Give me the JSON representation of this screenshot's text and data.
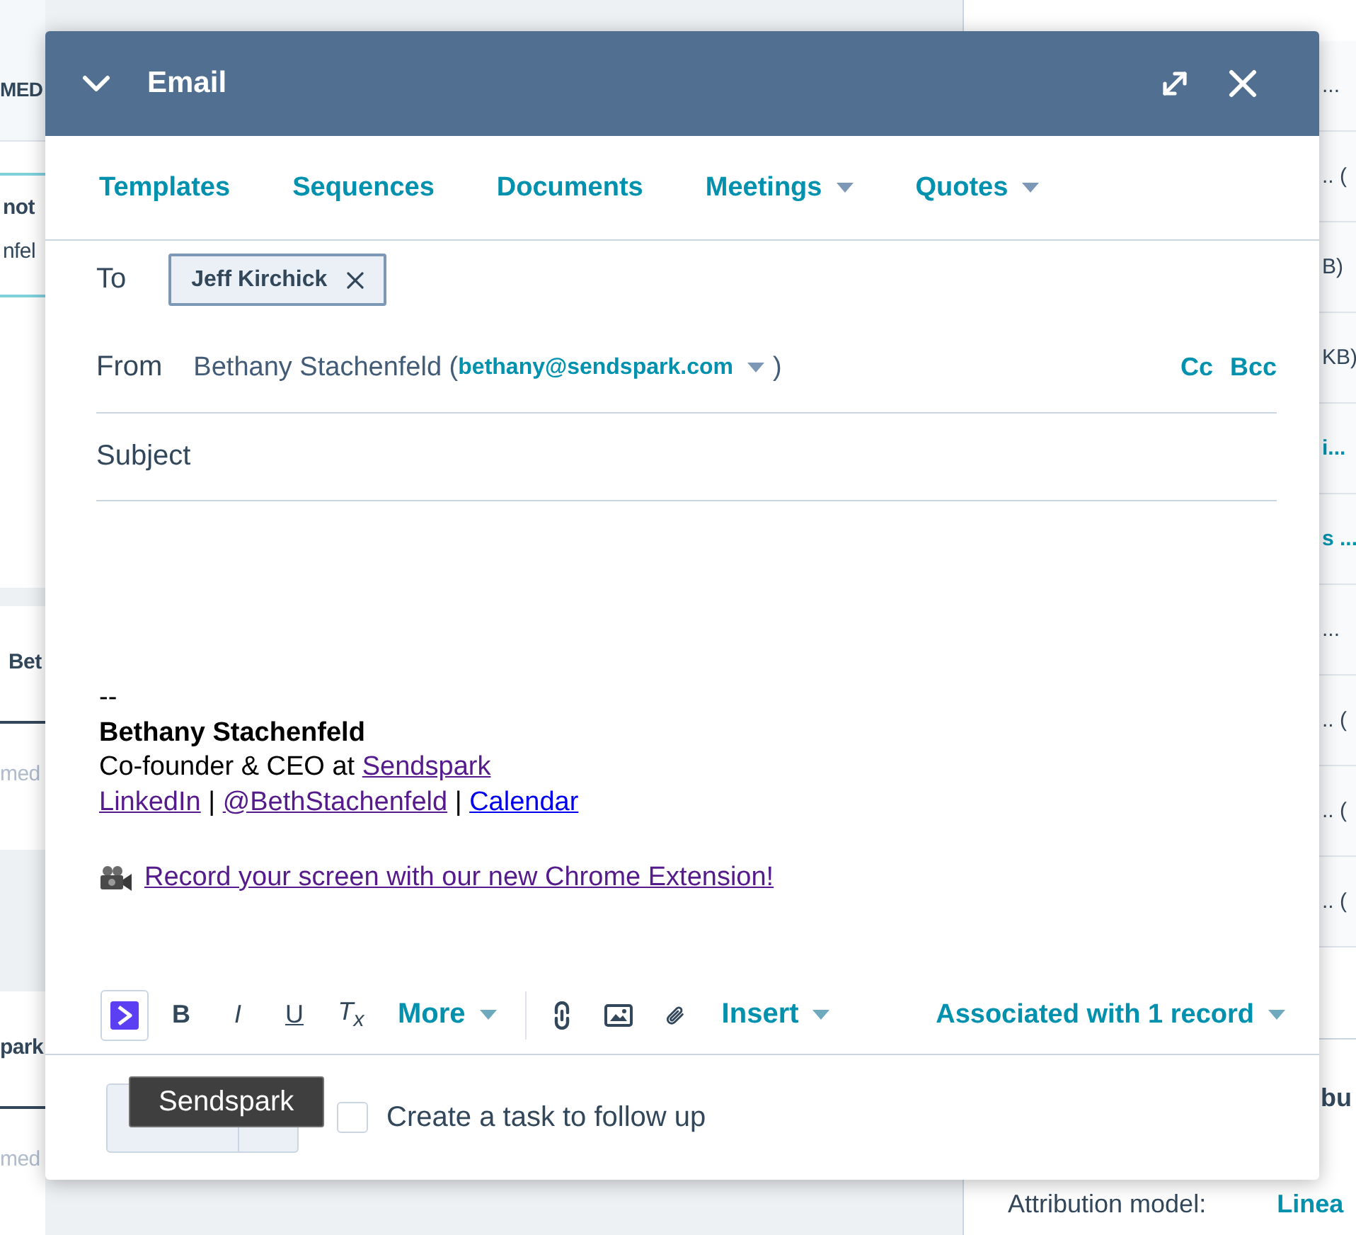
{
  "background": {
    "left_cards": [
      {
        "kind": "header",
        "lines": [
          "MED"
        ]
      },
      {
        "kind": "note",
        "lines": [
          "not",
          "nfel"
        ]
      },
      {
        "kind": "item",
        "lines": [
          "Bet",
          "med"
        ]
      },
      {
        "kind": "item",
        "lines": [
          "park",
          "med"
        ]
      }
    ],
    "right_rows": [
      {
        "text": "...",
        "kind": "text"
      },
      {
        "text": ".. (",
        "kind": "text"
      },
      {
        "text": "B)",
        "kind": "text"
      },
      {
        "text": "KB)",
        "kind": "text"
      },
      {
        "text": "i...",
        "kind": "link"
      },
      {
        "text": "s ...",
        "kind": "link"
      },
      {
        "text": "...",
        "kind": "text"
      },
      {
        "text": ".. (",
        "kind": "text"
      },
      {
        "text": ".. (",
        "kind": "text"
      },
      {
        "text": ".. (",
        "kind": "text"
      }
    ],
    "right_section": {
      "heading": "bu",
      "attribution_label": "Attribution model:",
      "attribution_value": "Linea"
    }
  },
  "email_window": {
    "title": "Email",
    "tabs": [
      {
        "label": "Templates",
        "dropdown": false
      },
      {
        "label": "Sequences",
        "dropdown": false
      },
      {
        "label": "Documents",
        "dropdown": false
      },
      {
        "label": "Meetings",
        "dropdown": true
      },
      {
        "label": "Quotes",
        "dropdown": true
      }
    ],
    "to": {
      "label": "To",
      "recipients": [
        "Jeff Kirchick"
      ]
    },
    "from": {
      "label": "From",
      "sender_name": "Bethany Stachenfeld",
      "sender_email": "bethany@sendspark.com",
      "brackets": [
        "(",
        ")"
      ],
      "copy_links": [
        "Cc",
        "Bcc"
      ]
    },
    "subject": {
      "label": "Subject"
    },
    "signature": {
      "separator": "--",
      "name": "Bethany Stachenfeld",
      "lines": [
        [
          {
            "text": "Co-founder & CEO at ",
            "kind": "text"
          },
          {
            "text": "Sendspark",
            "kind": "visited_link"
          }
        ],
        [
          {
            "text": "LinkedIn",
            "kind": "visited_link"
          },
          {
            "text": " | ",
            "kind": "text"
          },
          {
            "text": "@BethStachenfeld",
            "kind": "visited_link"
          },
          {
            "text": " | ",
            "kind": "text"
          },
          {
            "text": "Calendar",
            "kind": "link"
          }
        ]
      ],
      "promo": {
        "text": "Record your screen with our new Chrome Extension!",
        "kind": "visited_link"
      }
    },
    "toolbar": {
      "format_buttons": [
        {
          "kind": "sendspark"
        },
        {
          "kind": "bold",
          "glyph": "B"
        },
        {
          "kind": "italic",
          "glyph": "I"
        },
        {
          "kind": "underline",
          "glyph": "U"
        },
        {
          "kind": "clear",
          "glyph": "T$_{x}$"
        }
      ],
      "more": "More",
      "insert_buttons": [
        {
          "kind": "link"
        },
        {
          "kind": "image"
        },
        {
          "kind": "attachment"
        }
      ],
      "insert": "Insert",
      "associated": "Associated with 1 record"
    },
    "footer": {
      "tooltip": "Sendspark",
      "followup": {
        "label": "Create a task to follow up",
        "checked": false
      }
    }
  }
}
